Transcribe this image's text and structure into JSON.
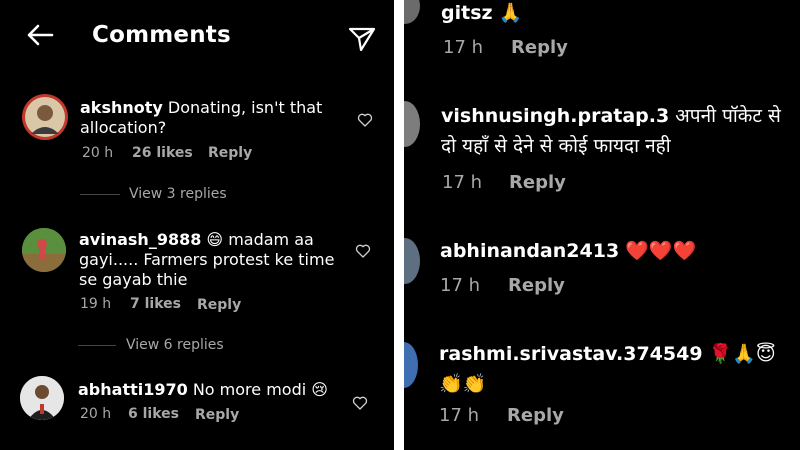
{
  "left": {
    "header": {
      "title": "Comments"
    },
    "comments": [
      {
        "user": "akshnoty",
        "text": " Donating, isn't that allocation?",
        "time": "20 h",
        "likes": "26 likes",
        "reply": "Reply",
        "view_replies": "View 3 replies"
      },
      {
        "user": "avinash_9888",
        "text": " 😄 madam aa gayi..... Farmers protest ke time se gayab thie",
        "time": "19 h",
        "likes": "7 likes",
        "reply": "Reply",
        "view_replies": "View 6 replies"
      },
      {
        "user": "abhatti1970",
        "text": " No more modi 😢",
        "time": "20 h",
        "likes": "6 likes",
        "reply": "Reply"
      }
    ]
  },
  "right": {
    "comments": [
      {
        "user": "gitsz",
        "text": " 🙏",
        "time": "17 h",
        "reply": "Reply"
      },
      {
        "user": "vishnusingh.pratap.3",
        "text": " अपनी पॉकेट से दो यहाँ से देने से कोई फायदा नही",
        "time": "17 h",
        "reply": "Reply"
      },
      {
        "user": "abhinandan2413",
        "text": " ❤️❤️❤️",
        "time": "17 h",
        "reply": "Reply"
      },
      {
        "user": "rashmi.srivastav.374549",
        "text": " 🌹🙏😇 👏👏",
        "time": "17 h",
        "reply": "Reply"
      }
    ]
  },
  "colors": {
    "background": "#000000",
    "text": "#ffffff",
    "meta": "#a8a8a8"
  },
  "icons": [
    "back-arrow-icon",
    "send-icon",
    "heart-icon"
  ]
}
